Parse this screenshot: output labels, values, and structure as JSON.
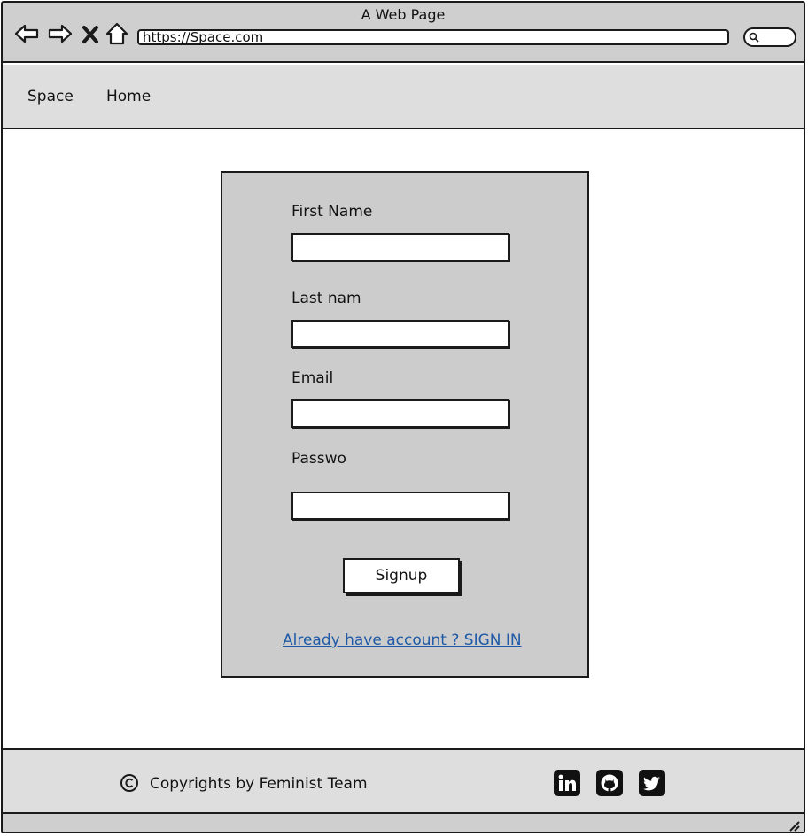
{
  "window": {
    "title": "A Web Page",
    "url": "https://Space.com"
  },
  "icons": {
    "back": "back-arrow-icon",
    "forward": "forward-arrow-icon",
    "stop": "close-icon",
    "home": "home-icon",
    "search": "search-icon",
    "copyright": "copyright-icon",
    "linkedin": "linkedin-icon",
    "github": "github-icon",
    "twitter": "twitter-icon"
  },
  "nav": {
    "brand": "Space",
    "home": "Home"
  },
  "form": {
    "fields": [
      {
        "label": "First Name",
        "value": ""
      },
      {
        "label": "Last nam",
        "value": ""
      },
      {
        "label": "Email",
        "value": ""
      },
      {
        "label": "Passwo",
        "value": ""
      }
    ],
    "submit_label": "Signup",
    "signin_link": "Already have account ? SIGN IN"
  },
  "footer": {
    "copyright": "Copyrights by Feminist Team"
  },
  "colors": {
    "chrome": "#cfcfcf",
    "nav_bg": "#dedede",
    "card_bg": "#cccccc",
    "link": "#1f5aa6"
  }
}
